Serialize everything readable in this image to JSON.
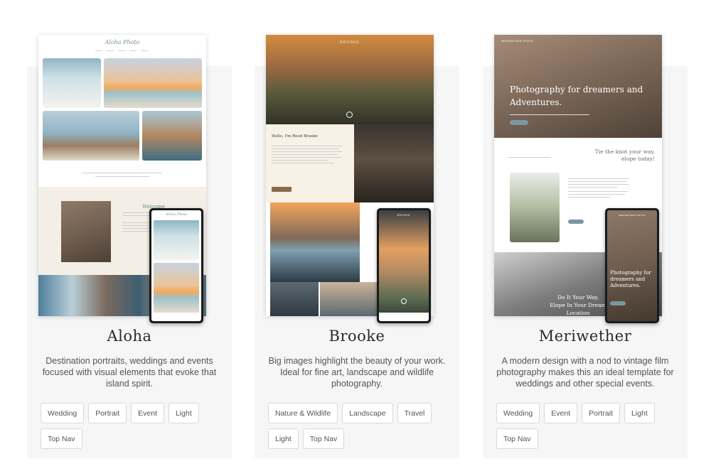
{
  "templates": [
    {
      "name": "Aloha",
      "description": "Destination portraits, weddings and events focused with visual elements that evoke that island spirit.",
      "tags": [
        "Wedding",
        "Portrait",
        "Event",
        "Light",
        "Top Nav"
      ],
      "preview": {
        "logo": "Aloha Photo",
        "welcome": "Welcome"
      }
    },
    {
      "name": "Brooke",
      "description": "Big images highlight the beauty of your work. Ideal for fine art, landscape and wildlife photography.",
      "tags": [
        "Nature & Wildlife",
        "Landscape",
        "Travel",
        "Light",
        "Top Nav"
      ],
      "preview": {
        "logo": "BROOKE",
        "intro": "Hello, I'm Reed Brooke"
      }
    },
    {
      "name": "Meriwether",
      "description": "A modern design with a nod to vintage film photography makes this an ideal template for weddings and other special events.",
      "tags": [
        "Wedding",
        "Event",
        "Portrait",
        "Light",
        "Top Nav"
      ],
      "preview": {
        "logo": "MERIWETHER PHOTO",
        "hero": "Photography for dreamers and Adventures.",
        "quote": "Tie the knot your way, elope today!",
        "banner": "Do It Your Way. Elope In Your Dream Location",
        "phone_hero": "Photography for dreamers and Adventures."
      }
    }
  ]
}
